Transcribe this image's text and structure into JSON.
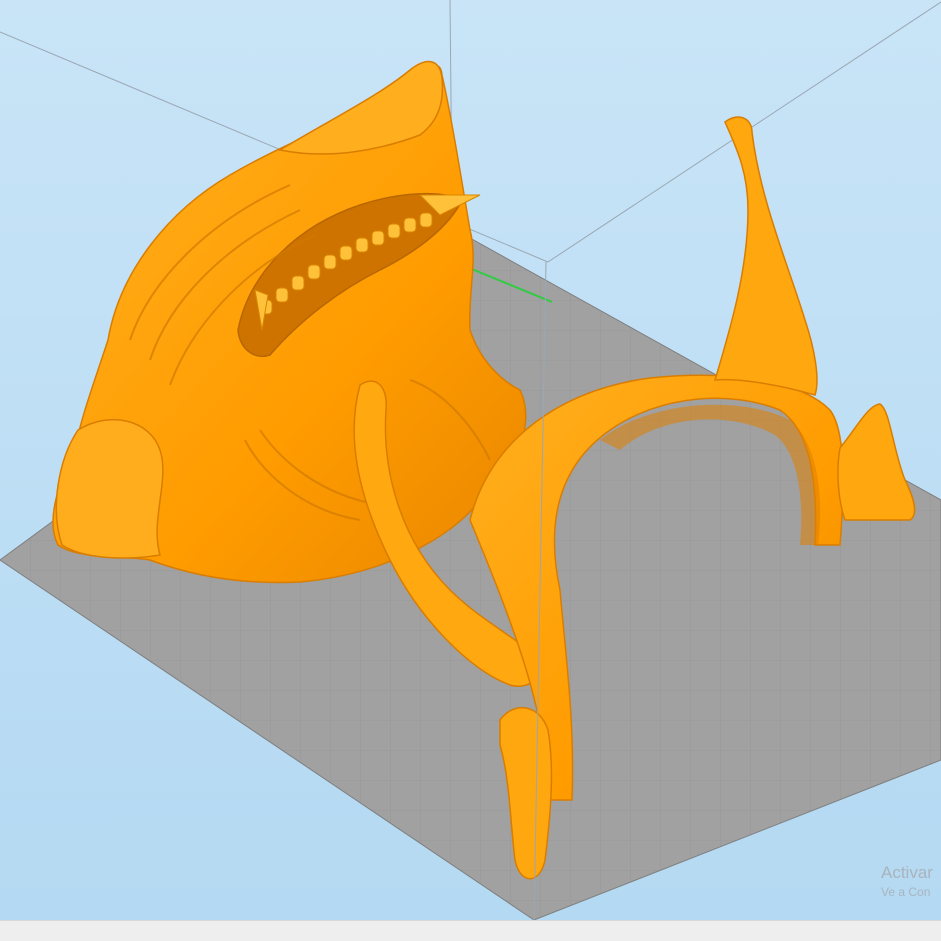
{
  "app": {
    "view": "3D build plate preview",
    "model_color": "#ff9f00",
    "plate_color": "#a0a0a0"
  },
  "axes": {
    "x_color": "#2ecc40",
    "y_color": "#2f3fd9"
  },
  "watermark": {
    "line1": "Activar",
    "line2": "Ve a Con"
  }
}
